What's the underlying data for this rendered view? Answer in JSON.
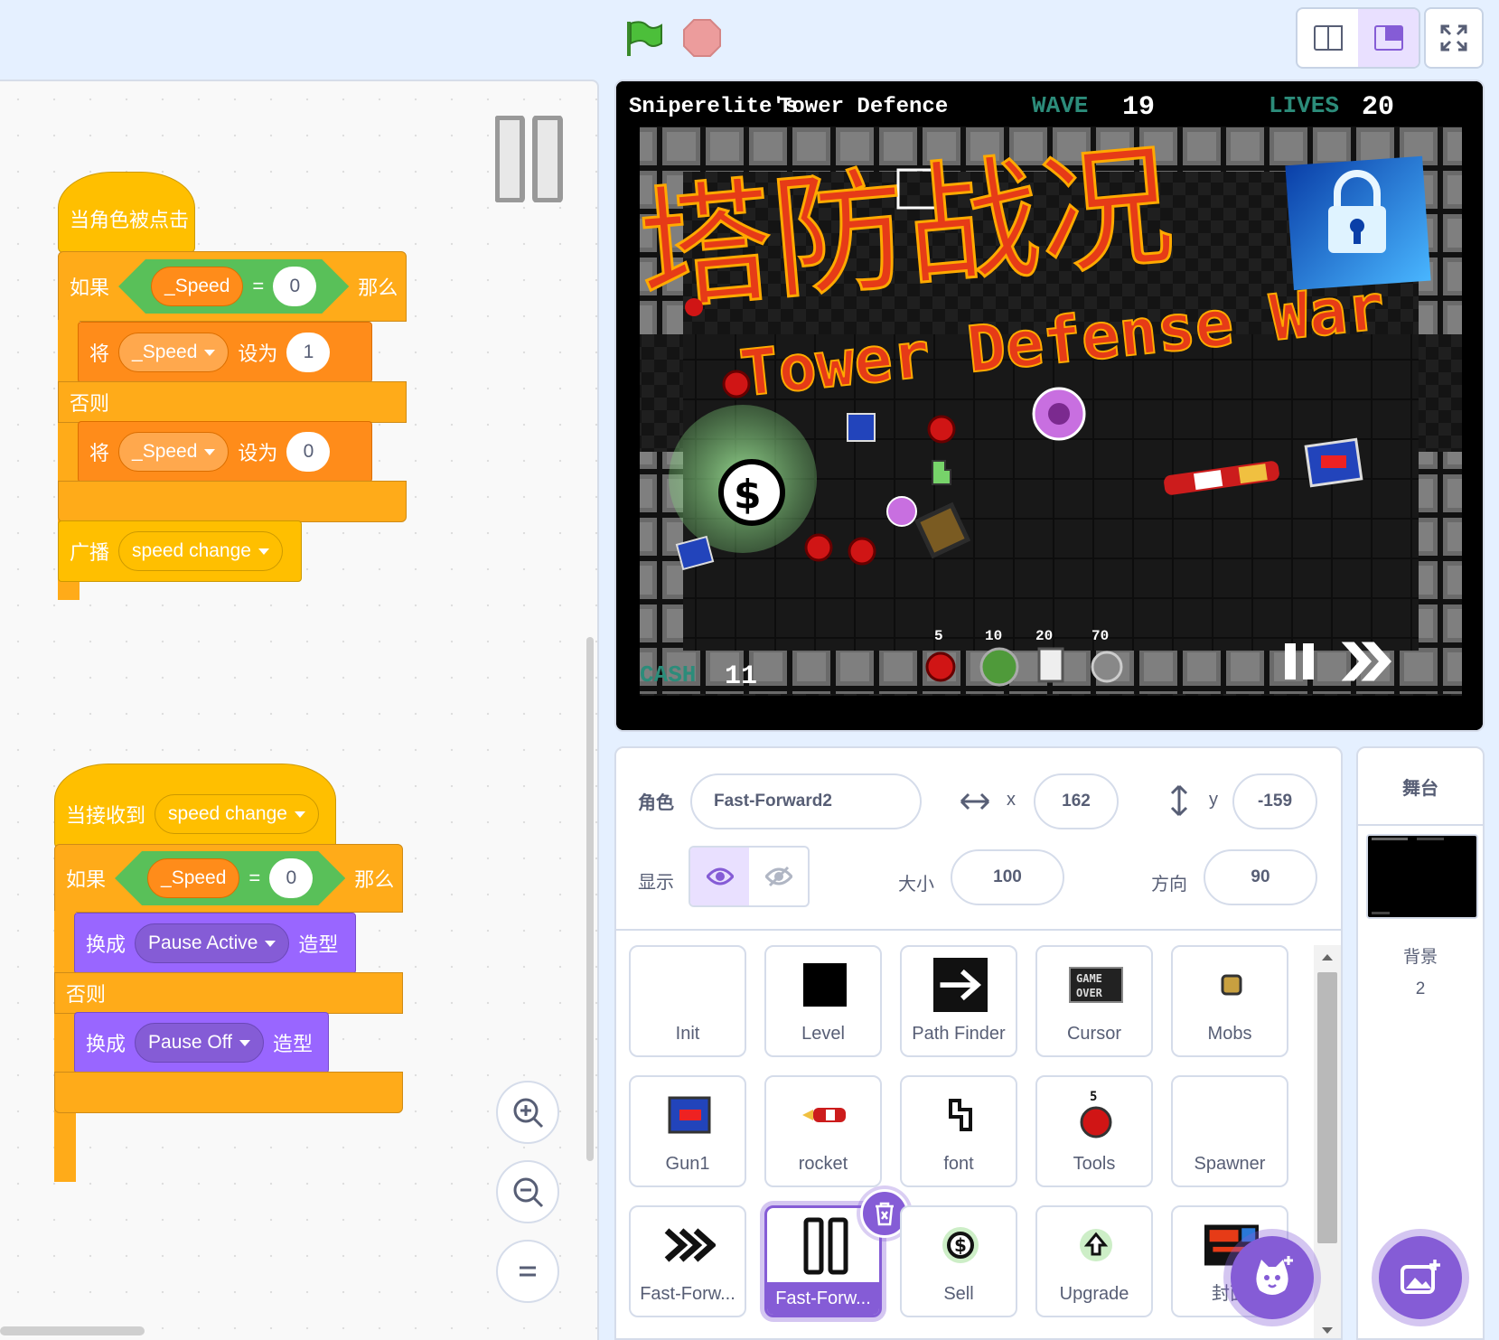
{
  "toolbar": {
    "green_flag": "green-flag-icon",
    "stop": "stop-icon",
    "layout_small": "small-stage-icon",
    "layout_large": "large-stage-icon",
    "fullscreen": "fullscreen-icon"
  },
  "script1": {
    "hat": "当角色被点击",
    "if_label": "如果",
    "var1": "_Speed",
    "eq": "=",
    "val_zero": "0",
    "then_label": "那么",
    "set_label": "将",
    "set_var": "_Speed",
    "set_to": "设为",
    "set_val1": "1",
    "else_label": "否则",
    "set_var2": "_Speed",
    "set_val2": "0",
    "broadcast_label": "广播",
    "broadcast_msg": "speed change"
  },
  "script2": {
    "hat": "当接收到",
    "hat_msg": "speed change",
    "if_label": "如果",
    "var1": "_Speed",
    "eq": "=",
    "val_zero": "0",
    "then_label": "那么",
    "switch_label": "换成",
    "costume1": "Pause Active",
    "costume_suffix": "造型",
    "else_label": "否则",
    "costume2": "Pause Off"
  },
  "stage": {
    "author_title": "Sniperelite's",
    "game_title": "Tower Defence",
    "wave_label": "WAVE",
    "wave_value": "19",
    "lives_label": "LIVES",
    "lives_value": "20",
    "banner_cn": "塔防战况",
    "banner_en": "Tower Defense War",
    "cash_label": "CASH",
    "cash_value": "11",
    "shop_prices": [
      "5",
      "10",
      "20",
      "70"
    ]
  },
  "sprite_info": {
    "sprite_label": "角色",
    "sprite_name": "Fast-Forward2",
    "x_label": "x",
    "x_value": "162",
    "y_label": "y",
    "y_value": "-159",
    "show_label": "显示",
    "size_label": "大小",
    "size_value": "100",
    "direction_label": "方向",
    "direction_value": "90"
  },
  "sprites": [
    {
      "name": "Init",
      "icon": "blank"
    },
    {
      "name": "Level",
      "icon": "black-square-icon"
    },
    {
      "name": "Path Finder",
      "icon": "arrow-right-icon"
    },
    {
      "name": "Cursor",
      "icon": "game-over-icon"
    },
    {
      "name": "Mobs",
      "icon": "mob-icon"
    },
    {
      "name": "Gun1",
      "icon": "gun-icon"
    },
    {
      "name": "rocket",
      "icon": "rocket-icon"
    },
    {
      "name": "font",
      "icon": "font-icon"
    },
    {
      "name": "Tools",
      "icon": "tools-icon"
    },
    {
      "name": "Spawner",
      "icon": "blank"
    },
    {
      "name": "Fast-Forw...",
      "icon": "fast-forward-icon"
    },
    {
      "name": "Fast-Forw...",
      "icon": "pause-icon",
      "selected": true
    },
    {
      "name": "Sell",
      "icon": "sell-icon"
    },
    {
      "name": "Upgrade",
      "icon": "upgrade-icon"
    },
    {
      "name": "封面",
      "icon": "cover-icon"
    }
  ],
  "stage_panel": {
    "header": "舞台",
    "backdrop_label": "背景",
    "backdrop_count": "2"
  },
  "colors": {
    "events": "#ffbf00",
    "control": "#ffab19",
    "variables": "#ff8c1a",
    "operators": "#59c059",
    "looks": "#9966ff",
    "accent": "#855cd6"
  }
}
